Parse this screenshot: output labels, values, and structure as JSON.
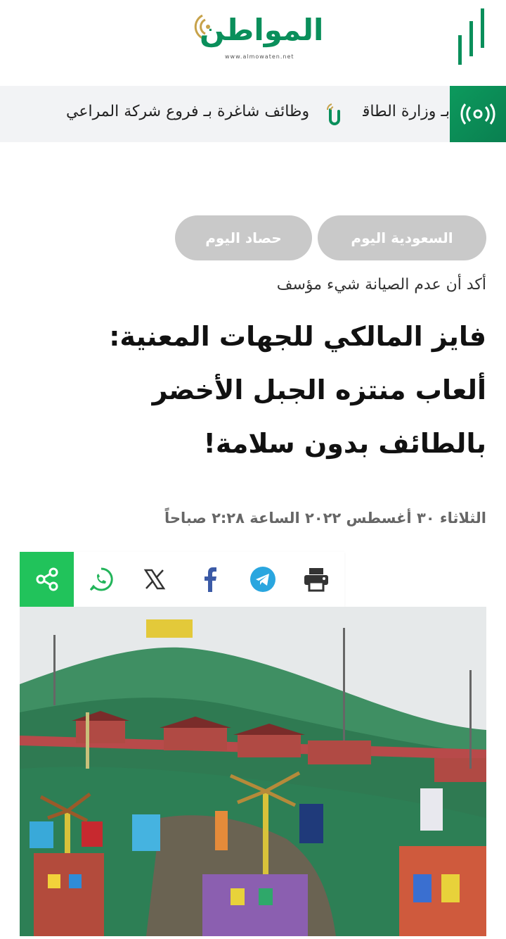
{
  "header": {
    "logo_text": "المواطن",
    "logo_sub": "www.almowaten.net",
    "menu_icon": "menu-bars-icon"
  },
  "ticker": {
    "badge_icon": "broadcast-icon",
    "items": [
      "وظائف شاغرة بـ فروع شركة المراعي",
      "بـ وزارة الطاقة"
    ],
    "separator_icon": "logo-mark-icon"
  },
  "categories": [
    "السعودية اليوم",
    "حصاد اليوم"
  ],
  "article": {
    "subtitle": "أكد أن عدم الصيانة شيء مؤسف",
    "headline": "فايز المالكي للجهات المعنية: ألعاب منتزه الجبل الأخضر بالطائف بدون سلامة!",
    "date": "الثلاثاء ٣٠ أغسطس ٢٠٢٢ الساعة ٢:٢٨ صباحاً"
  },
  "share": {
    "icons": [
      "share-icon",
      "whatsapp-icon",
      "x-icon",
      "facebook-icon",
      "telegram-icon",
      "print-icon"
    ],
    "colors": {
      "share_bg": "#21c35b",
      "whatsapp": "#22b45a",
      "facebook": "#3b5aa6",
      "telegram": "#2aa6df"
    }
  },
  "colors": {
    "brand_green": "#0a8f5b",
    "pill_bg": "#c9c9c9",
    "ticker_bg": "#f2f3f5"
  }
}
